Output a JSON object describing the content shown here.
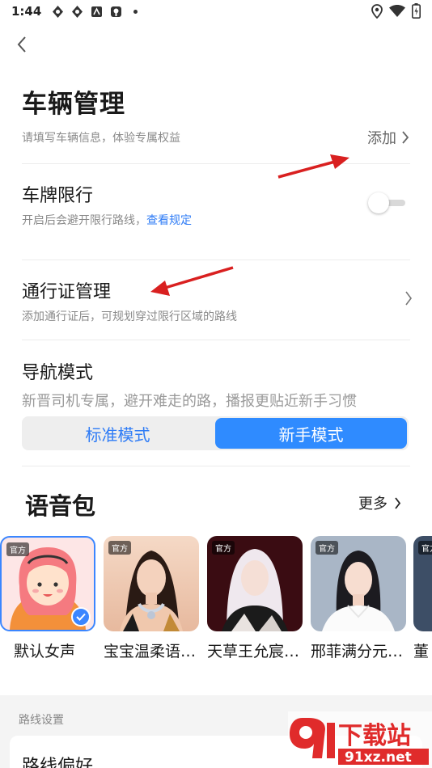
{
  "status_bar": {
    "time": "1:44",
    "left_icons": [
      "app-icon",
      "app-icon",
      "app-icon",
      "app-icon",
      "dot"
    ],
    "right_icons": [
      "location-icon",
      "wifi-icon",
      "battery-icon"
    ]
  },
  "header": {
    "title": "车辆管理"
  },
  "vehicle": {
    "subtitle": "请填写车辆信息，体验专属权益",
    "add_label": "添加"
  },
  "plate_limit": {
    "title": "车牌限行",
    "subtitle": "开启后会避开限行路线，",
    "link": "查看规定",
    "enabled": false
  },
  "pass": {
    "title": "通行证管理",
    "subtitle": "添加通行证后，可规划穿过限行区域的路线"
  },
  "nav_mode": {
    "title": "导航模式",
    "subtitle": "新晋司机专属，避开难走的路，播报更贴近新手习惯",
    "options": [
      "标准模式",
      "新手模式"
    ],
    "selected": "新手模式"
  },
  "voice": {
    "title": "语音包",
    "more_label": "更多",
    "items": [
      {
        "name": "默认女声",
        "badge": "官方",
        "selected": true
      },
      {
        "name": "宝宝温柔语…",
        "badge": "官方",
        "selected": false
      },
      {
        "name": "天草王允宸…",
        "badge": "官方",
        "selected": false
      },
      {
        "name": "邢菲满分元…",
        "badge": "官方",
        "selected": false
      },
      {
        "name": "董",
        "badge": "官方",
        "selected": false
      }
    ]
  },
  "route": {
    "section_label": "路线设置",
    "preference_label": "路线偏好"
  },
  "watermark": {
    "logo_text": "下载站",
    "site": "91xz.net"
  },
  "colors": {
    "accent": "#2f8bff",
    "link": "#2f7cf6",
    "annotation_arrow": "#d92020",
    "watermark_red": "#e02b2b"
  }
}
